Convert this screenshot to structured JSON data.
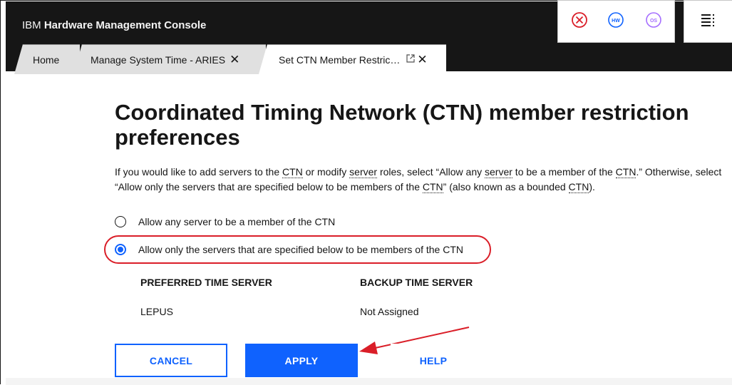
{
  "header": {
    "brand": "IBM",
    "product": "Hardware Management Console",
    "icons": [
      "close-circle-icon",
      "hw-icon",
      "os-icon",
      "menu-icon"
    ],
    "hw_label": "HW",
    "os_label": "OS",
    "colors": {
      "header_bg": "#161616",
      "close_red": "#da1e28",
      "hw_blue": "#0f62fe",
      "os_purple": "#a56eff"
    }
  },
  "tabs": [
    {
      "label": "Home"
    },
    {
      "label": "Manage System Time - ARIES"
    },
    {
      "label": "Set CTN Member Restric…"
    }
  ],
  "page": {
    "title": "Coordinated Timing Network (CTN) member restriction preferences",
    "intro": {
      "p1": "If you would like to add servers to the ",
      "ctn1": "CTN",
      "p2": " or modify ",
      "server1": "server",
      "p3": " roles, select “Allow any ",
      "server2": "server",
      "p4": " to be a member of the ",
      "ctn2": "CTN",
      "p5": ".” Otherwise, select “Allow only the servers that are specified below to be members of the ",
      "ctn3": "CTN",
      "p6": "” (also known as a bounded ",
      "ctn4": "CTN",
      "p7": ")."
    },
    "options": [
      {
        "label": "Allow any server to be a member of the CTN",
        "selected": false
      },
      {
        "label": "Allow only the servers that are specified below to be members of the CTN",
        "selected": true
      }
    ],
    "table": {
      "headers": [
        "PREFERRED TIME SERVER",
        "BACKUP TIME SERVER"
      ],
      "values": [
        "LEPUS",
        "Not Assigned"
      ]
    },
    "buttons": {
      "cancel": "CANCEL",
      "apply": "APPLY",
      "help": "HELP"
    },
    "accent": "#0f62fe"
  }
}
